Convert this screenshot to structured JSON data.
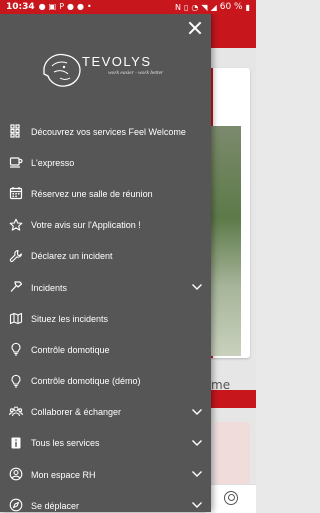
{
  "status_bar": {
    "time": "10:34",
    "battery": "60 %"
  },
  "brand": {
    "name": "TEVOLYS",
    "tagline": "work easier · work better"
  },
  "background": {
    "visible_word": "me"
  },
  "menu": {
    "items": [
      {
        "label": "Découvrez vos services Feel Welcome",
        "icon": "grid-icon",
        "expandable": false
      },
      {
        "label": "L'expresso",
        "icon": "coffee-cup-icon",
        "expandable": false
      },
      {
        "label": "Réservez une salle de réunion",
        "icon": "calendar-icon",
        "expandable": false
      },
      {
        "label": "Votre avis sur l'Application !",
        "icon": "star-icon",
        "expandable": false
      },
      {
        "label": "Déclarez un incident",
        "icon": "wrench-icon",
        "expandable": false
      },
      {
        "label": "Incidents",
        "icon": "hammer-icon",
        "expandable": true
      },
      {
        "label": "Situez les incidents",
        "icon": "map-icon",
        "expandable": false
      },
      {
        "label": "Contrôle domotique",
        "icon": "lightbulb-icon",
        "expandable": false
      },
      {
        "label": "Contrôle domotique (démo)",
        "icon": "lightbulb-icon",
        "expandable": false
      },
      {
        "label": "Collaborer & échanger",
        "icon": "users-icon",
        "expandable": true
      },
      {
        "label": "Tous les services",
        "icon": "info-icon",
        "expandable": true
      },
      {
        "label": "Mon espace RH",
        "icon": "user-circle-icon",
        "expandable": true
      },
      {
        "label": "Se déplacer",
        "icon": "compass-icon",
        "expandable": true
      }
    ]
  },
  "colors": {
    "accent": "#c8161d",
    "drawer_bg": "#565656"
  }
}
